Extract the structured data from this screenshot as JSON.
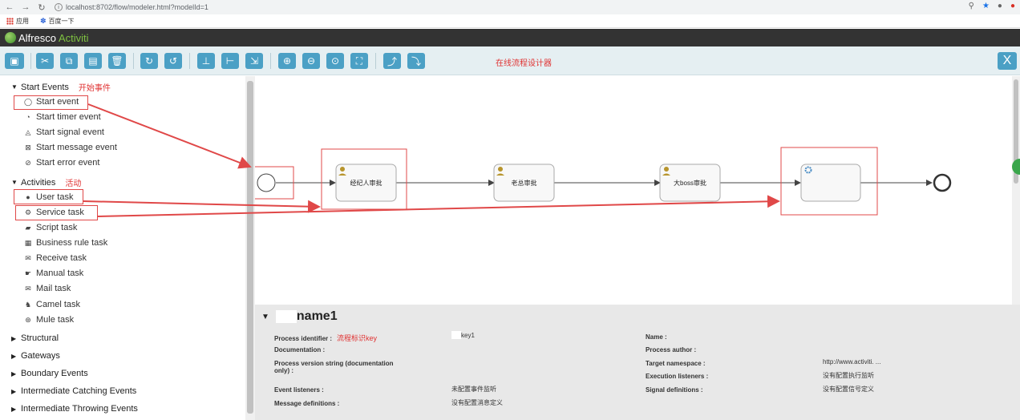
{
  "browser": {
    "url": "localhost:8702/flow/modeler.html?modelId=1",
    "bookmarks": [
      {
        "label": "应用"
      },
      {
        "label": "百度一下"
      }
    ]
  },
  "app": {
    "brand_main": "Alfresco",
    "brand_accent": "Activiti",
    "toolbar_note": "在线流程设计器",
    "close_label": "X"
  },
  "toolbar_icons": [
    "save-icon",
    "cut-icon",
    "copy-icon",
    "paste-icon",
    "delete-icon",
    "redo-icon",
    "undo-icon",
    "align-vertical-icon",
    "align-horizontal-icon",
    "same-size-icon",
    "zoom-in-icon",
    "zoom-out-icon",
    "zoom-actual-icon",
    "zoom-fit-icon",
    "bendpoint-add-icon",
    "bendpoint-remove-icon"
  ],
  "palette": {
    "start_events": {
      "label": "Start Events",
      "note": "开始事件"
    },
    "start_items": [
      {
        "label": "Start event",
        "icon": "circle-icon"
      },
      {
        "label": "Start timer event",
        "icon": "timer-icon"
      },
      {
        "label": "Start signal event",
        "icon": "signal-icon"
      },
      {
        "label": "Start message event",
        "icon": "message-icon"
      },
      {
        "label": "Start error event",
        "icon": "error-icon"
      }
    ],
    "activities": {
      "label": "Activities",
      "note": "活动"
    },
    "activity_items": [
      {
        "label": "User task",
        "icon": "user-icon"
      },
      {
        "label": "Service task",
        "icon": "gear-icon"
      },
      {
        "label": "Script task",
        "icon": "script-icon"
      },
      {
        "label": "Business rule task",
        "icon": "table-icon"
      },
      {
        "label": "Receive task",
        "icon": "envelope-icon"
      },
      {
        "label": "Manual task",
        "icon": "hand-icon"
      },
      {
        "label": "Mail task",
        "icon": "mail-icon"
      },
      {
        "label": "Camel task",
        "icon": "camel-icon"
      },
      {
        "label": "Mule task",
        "icon": "mule-icon"
      }
    ],
    "collapsed_groups": [
      {
        "label": "Structural"
      },
      {
        "label": "Gateways"
      },
      {
        "label": "Boundary Events"
      },
      {
        "label": "Intermediate Catching Events"
      },
      {
        "label": "Intermediate Throwing Events"
      }
    ]
  },
  "diagram": {
    "tasks": [
      {
        "label": "经纪人审批",
        "type": "user"
      },
      {
        "label": "老总审批",
        "type": "user"
      },
      {
        "label": "大boss审批",
        "type": "user"
      },
      {
        "label": "",
        "type": "service"
      }
    ]
  },
  "properties": {
    "title": "name1",
    "fields": {
      "process_identifier": {
        "label": "Process identifier :",
        "note": "流程标识key",
        "value": "key1"
      },
      "documentation": {
        "label": "Documentation :"
      },
      "process_version": {
        "label_line1": "Process version string (documentation",
        "label_line2": "only) :"
      },
      "event_listeners": {
        "label": "Event listeners :",
        "value": "未配置事件监听"
      },
      "message_definitions": {
        "label": "Message definitions :",
        "value": "没有配置消息定义"
      },
      "name": {
        "label": "Name :"
      },
      "process_author": {
        "label": "Process author :"
      },
      "target_namespace": {
        "label": "Target namespace :",
        "value": "http://www.activiti. ..."
      },
      "execution_listeners": {
        "label": "Execution listeners :",
        "value": "没有配置执行监听"
      },
      "signal_definitions": {
        "label": "Signal definitions :",
        "value": "没有配置信号定义"
      }
    }
  },
  "colors": {
    "accent": "#4ba0c5",
    "annotation_red": "#e04848",
    "header_dark": "#333333"
  }
}
